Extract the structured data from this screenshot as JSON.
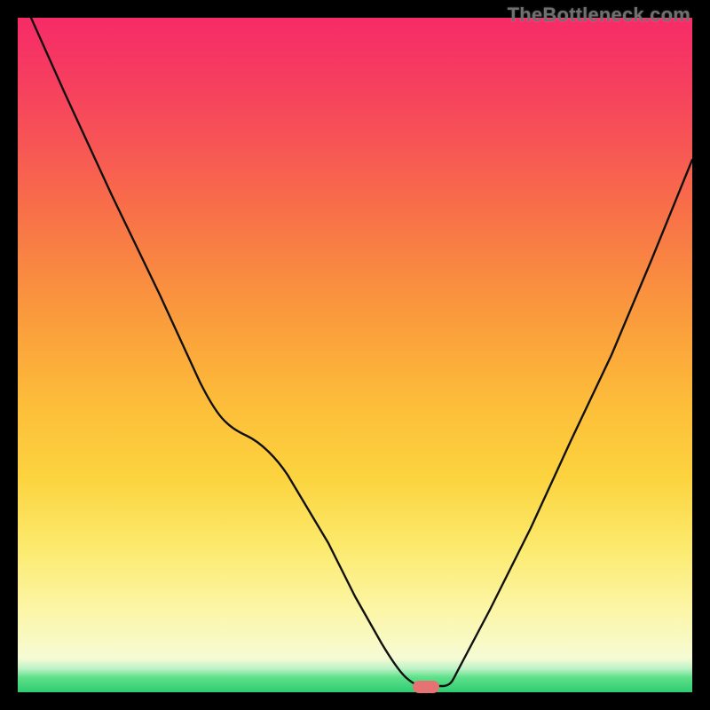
{
  "watermark": "TheBottleneck.com",
  "marker": {
    "x_frac": 0.605,
    "y_frac": 0.992
  },
  "chart_data": {
    "type": "line",
    "title": "",
    "xlabel": "",
    "ylabel": "",
    "xlim": [
      0,
      100
    ],
    "ylim": [
      0,
      100
    ],
    "grid": false,
    "legend": false,
    "series": [
      {
        "name": "bottleneck-curve",
        "x": [
          2,
          7,
          14,
          21,
          27,
          31,
          34,
          40,
          46,
          50,
          54,
          57.5,
          60,
          63,
          65,
          70,
          76,
          82,
          88,
          94,
          100
        ],
        "y": [
          100,
          89,
          74,
          59,
          46,
          40,
          38,
          32,
          22,
          14,
          7,
          2.3,
          1,
          1,
          2.8,
          12,
          24,
          37,
          50,
          64,
          79
        ]
      }
    ],
    "annotations": [
      {
        "type": "marker",
        "x": 60.5,
        "y": 0.8,
        "label": "optimal-zone"
      }
    ]
  }
}
